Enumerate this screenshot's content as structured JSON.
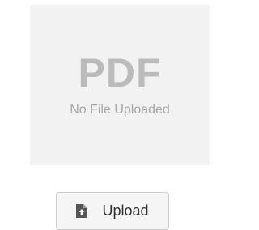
{
  "preview": {
    "badge": "PDF",
    "status": "No File Uploaded"
  },
  "upload_button": {
    "label": "Upload",
    "icon": "file-upload-icon"
  }
}
